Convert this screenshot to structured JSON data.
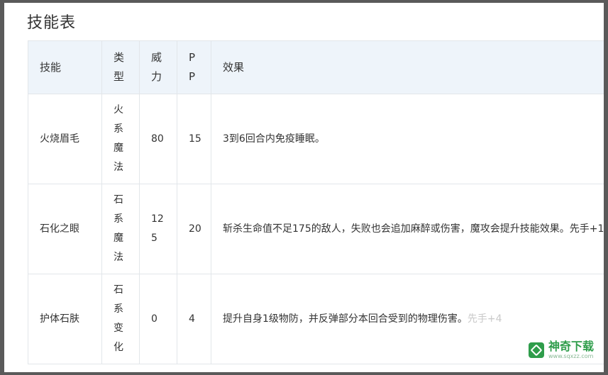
{
  "page": {
    "title": "技能表"
  },
  "table": {
    "headers": [
      "技能",
      "类型",
      "威力",
      "PP",
      "效果"
    ],
    "rows": [
      {
        "name": "火烧眉毛",
        "type": "火系魔法",
        "power": "80",
        "pp": "15",
        "effect": "3到6回合内免疫睡眠。",
        "effect_faded": ""
      },
      {
        "name": "石化之眼",
        "type": "石系魔法",
        "power": "125",
        "pp": "20",
        "effect": "斩杀生命值不足175的敌人，失败也会追加麻醉或伤害，魔攻会提升技能效果。先手+1",
        "effect_faded": ""
      },
      {
        "name": "护体石肤",
        "type": "石系变化",
        "power": "0",
        "pp": "4",
        "effect": "提升自身1级物防，并反弹部分本回合受到的物理伤害。",
        "effect_faded": "先手+4"
      }
    ]
  },
  "watermark": {
    "name": "神奇下载",
    "url": "www.sqxzz.com",
    "color": "#2f9d4b",
    "icon": "logo-icon"
  }
}
